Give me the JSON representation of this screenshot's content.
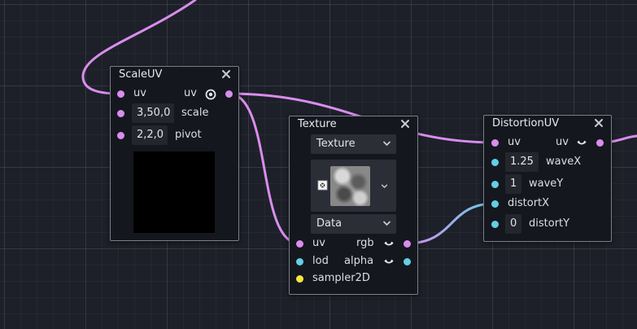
{
  "nodes": {
    "scale_uv": {
      "title": "ScaleUV",
      "input_uv": "uv",
      "output_uv": "uv",
      "scale_value": "3,50,0",
      "scale_label": "scale",
      "pivot_value": "2,2,0",
      "pivot_label": "pivot",
      "preview_color": "#000000"
    },
    "texture": {
      "title": "Texture",
      "source_dropdown": "Texture",
      "type_dropdown": "Data",
      "input_uv": "uv",
      "input_lod": "lod",
      "input_sampler": "sampler2D",
      "output_rgb": "rgb",
      "output_alpha": "alpha"
    },
    "distortion_uv": {
      "title": "DistortionUV",
      "input_uv": "uv",
      "output_uv": "uv",
      "wave_x_value": "1.25",
      "wave_x_label": "waveX",
      "wave_y_value": "1",
      "wave_y_label": "waveY",
      "distort_x_label": "distortX",
      "distort_y_value": "0",
      "distort_y_label": "distortY"
    }
  },
  "colors": {
    "background": "#1d2029",
    "port_vec3": "#d98ded",
    "port_float": "#62cfe6",
    "port_sampler": "#f5e83a",
    "node_border": "#7b7f88"
  },
  "icons": {
    "close": "close-icon",
    "visibility": "eye-icon",
    "preview_toggle": "preview-toggle-icon",
    "dropdown": "chevron-down-icon",
    "texture_placeholder": "texture-icon"
  }
}
